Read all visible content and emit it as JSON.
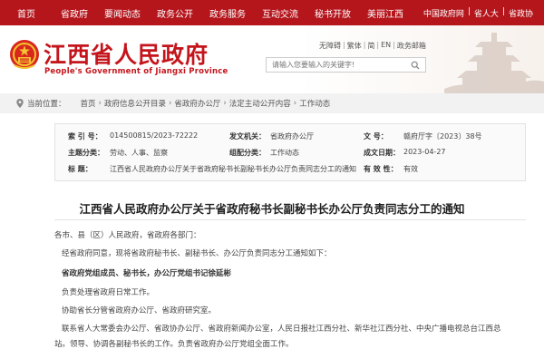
{
  "topnav": {
    "items": [
      "首页",
      "省政府",
      "要闻动态",
      "政务公开",
      "政务服务",
      "互动交流",
      "秘书开放",
      "美丽江西"
    ],
    "right_links": [
      "中国政府网",
      "|",
      "省人大",
      "|",
      "省政协"
    ]
  },
  "header": {
    "title": "江西省人民政府",
    "subtitle": "People's Government of Jiangxi Province",
    "tools": [
      "无障碍",
      "|",
      "繁体",
      "|",
      "简",
      "|",
      "EN",
      "|",
      "政务邮箱"
    ],
    "search_placeholder": "请输入您要输入的关键字!"
  },
  "breadcrumb": {
    "prefix": "当前位置：",
    "items": [
      "首页",
      "政府信息公开目录",
      "省政府办公厅",
      "法定主动公开内容",
      "工作动态"
    ]
  },
  "info": {
    "index_label": "索  引  号：",
    "index_value": "014500815/2023-72222",
    "issuer_label": "发文机关：",
    "issuer_value": "省政府办公厅",
    "docno_label": "文        号：",
    "docno_value": "赣府厅字〔2023〕38号",
    "subject_label": "主题分类：",
    "subject_value": "劳动、人事、监察",
    "genre_label": "组配分类：",
    "genre_value": "工作动态",
    "date_label": "成文日期：",
    "date_value": "2023-04-27",
    "title_label": "标        题：",
    "title_value": "江西省人民政府办公厅关于省政府秘书长副秘书长办公厅负责同志分工的通知",
    "valid_label": "有  效  性：",
    "valid_value": "有效"
  },
  "document": {
    "title": "江西省人民政府办公厅关于省政府秘书长副秘书长办公厅负责同志分工的通知",
    "paragraphs": [
      "各市、县（区）人民政府，省政府各部门：",
      "经省政府同意，现将省政府秘书长、副秘书长、办公厅负责同志分工通知如下：",
      "省政府党组成员、秘书长，办公厅党组书记徐延彬",
      "负责处理省政府日常工作。",
      "协助省长分管省政府办公厅、省政府研究室。",
      "联系省人大常委会办公厅、省政协办公厅、省政府新闻办公室，人民日报社江西分社、新华社江西分社、中央广播电视总台江西总",
      "站。领导、协调各副秘书长的工作。负责省政府办公厅党组全面工作。"
    ]
  },
  "colors": {
    "brand_red": "#b4161c"
  }
}
